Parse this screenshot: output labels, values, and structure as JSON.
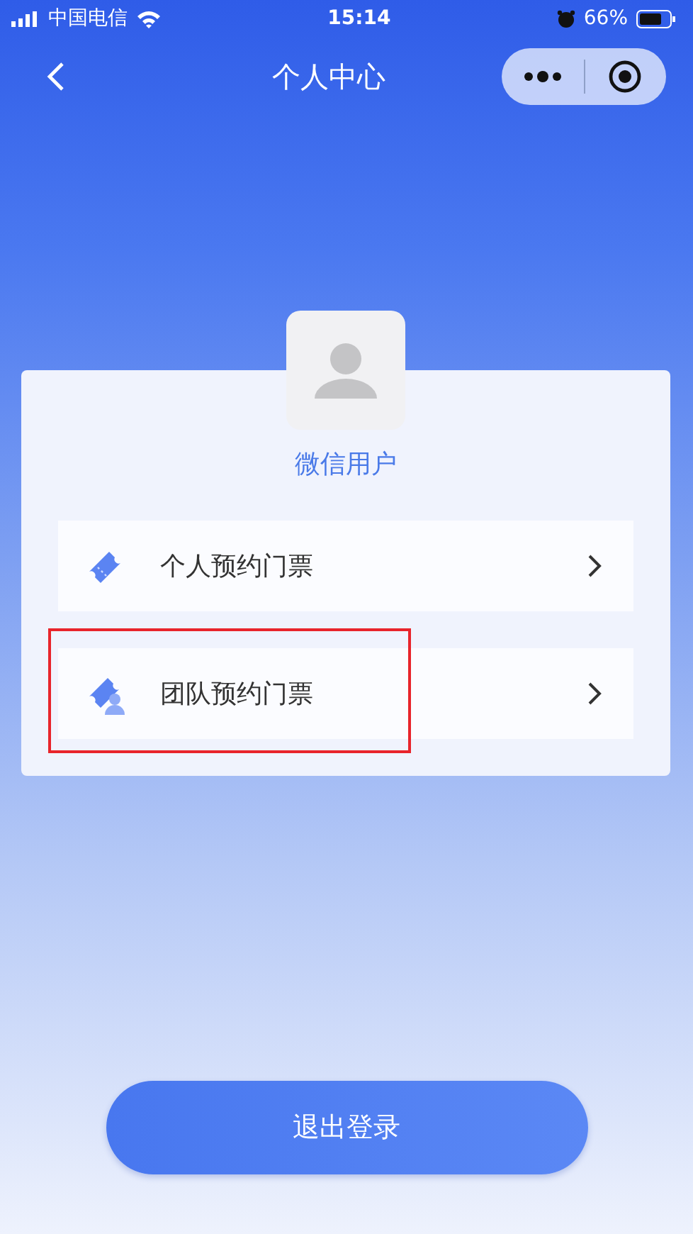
{
  "status_bar": {
    "carrier": "中国电信",
    "time": "15:14",
    "battery": "66%"
  },
  "nav": {
    "title": "个人中心"
  },
  "profile": {
    "name": "微信用户"
  },
  "menu": [
    {
      "label": "个人预约门票",
      "kind": "single",
      "highlighted": false
    },
    {
      "label": "团队预约门票",
      "kind": "group",
      "highlighted": true
    }
  ],
  "logout": {
    "label": "退出登录"
  }
}
